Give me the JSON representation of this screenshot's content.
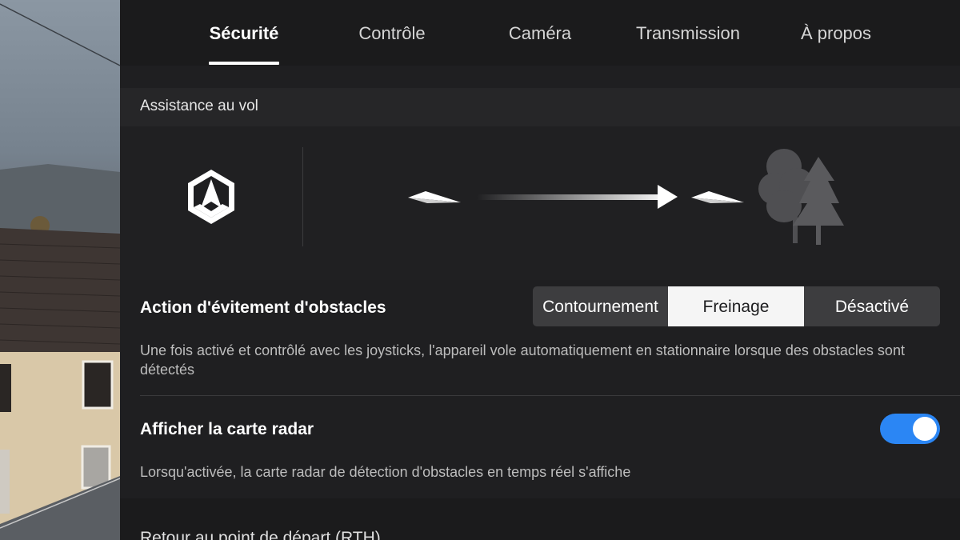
{
  "tabs": [
    {
      "label": "Sécurité",
      "active": true
    },
    {
      "label": "Contrôle",
      "active": false
    },
    {
      "label": "Caméra",
      "active": false
    },
    {
      "label": "Transmission",
      "active": false
    },
    {
      "label": "À propos",
      "active": false
    }
  ],
  "section": {
    "title": "Assistance au vol"
  },
  "obstacle_avoidance": {
    "title": "Action d'évitement d'obstacles",
    "options": [
      "Contournement",
      "Freinage",
      "Désactivé"
    ],
    "selected": "Freinage",
    "description": "Une fois activé et contrôlé avec les joysticks, l'appareil vole automatiquement en stationnaire lorsque des obstacles sont détectés"
  },
  "radar_map": {
    "title": "Afficher la carte radar",
    "enabled": true,
    "description": "Lorsqu'activée, la carte radar de détection d'obstacles en temps réel s'affiche"
  },
  "next_section": {
    "title": "Retour au point de départ (RTH)"
  },
  "colors": {
    "toggle_on": "#2b86f4",
    "panel_bg": "#1f1f21",
    "segment_selected": "#f5f5f5"
  },
  "icons": [
    "apas-hexagon-icon",
    "paper-plane-icon",
    "arrow-right-icon",
    "trees-icon"
  ]
}
